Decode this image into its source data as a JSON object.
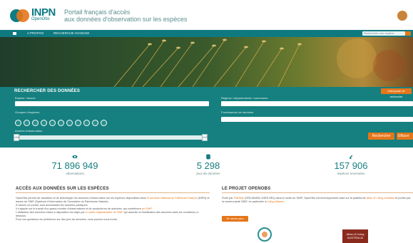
{
  "header": {
    "logo_text": "INPN",
    "logo_sub": "OpenObs",
    "tagline_line1": "Portail français d'accès",
    "tagline_line2": "aux données d'observation sur les espèces"
  },
  "nav": {
    "items": [
      "A PROPOS",
      "RECHERCHE AVANCEE"
    ],
    "search_placeholder": "Rechercher une espèce"
  },
  "search_panel": {
    "title": "RECHERCHER DES DONNÉES",
    "help_button": "Aide/guide de recherche",
    "species_label": "Espèce / taxons",
    "groups_label": "Groupes d'espèces",
    "years_label": "Années d'observation",
    "year_min": "1600",
    "year_max": "2023",
    "regions_label": "Régions / départements / communes",
    "providers_label": "Fournisseurs de données",
    "search_button": "Rechercher",
    "clear_button": "Effacer"
  },
  "stats": [
    {
      "value": "71 896 949",
      "caption": "observations",
      "icon": "eye-icon"
    },
    {
      "value": "5 298",
      "caption": "jeux de données",
      "icon": "database-icon"
    },
    {
      "value": "157 906",
      "caption": "espèces recensées",
      "icon": "lizard-icon"
    }
  ],
  "access_section": {
    "heading": "ACCÈS AUX DONNÉES SUR LES ESPÈCES",
    "p1a": "OpenObs permet de visualiser et de télécharger les données d'observation sur les espèces disponibles dans ",
    "p1_link": "l'Inventaire National du Patrimoine Naturel",
    "p1b": " (INPN) et issues du SINP (Système d'Information de l'Inventaire du Patrimoine Naturel).",
    "p2": "À travers ce portail, sont accessibles les données publiques.",
    "p3a": "Il s'appuie sur le travail d'un grand nombre d'observateurs et de producteurs de données, qui contribuent ",
    "p3_link": "au SINP",
    "p3b": ".",
    "p4a": "L'utilisation des données mises à disposition est régie par ",
    "p4_link": "le cadre réglementaire du SINP",
    "p4b": " qui autorise la réutilisation des données dans les conditions ci-dessous.",
    "p5": "Pour vos questions de pertinence sur des jeux de données, vous pouvez nous écrire."
  },
  "project_section": {
    "heading": "LE PROJET OPENOBS",
    "p1a": "Porté par ",
    "p1_link1": "PatriNat",
    "p1b": " (OFB-MNHN-CNRS-IRD) dans le cadre du SINP, OpenObs est techniquement basé sur la plateforme ",
    "p1_link2": "Atlas of Living Australia",
    "p1c": " et portée par la communauté GBIF, en particulier à ",
    "p1_link3": "Living Atlases",
    "p1d": ".",
    "more_button": "En savoir plus",
    "partner_logo2": "Atlas of Living AUSTRALIA"
  }
}
